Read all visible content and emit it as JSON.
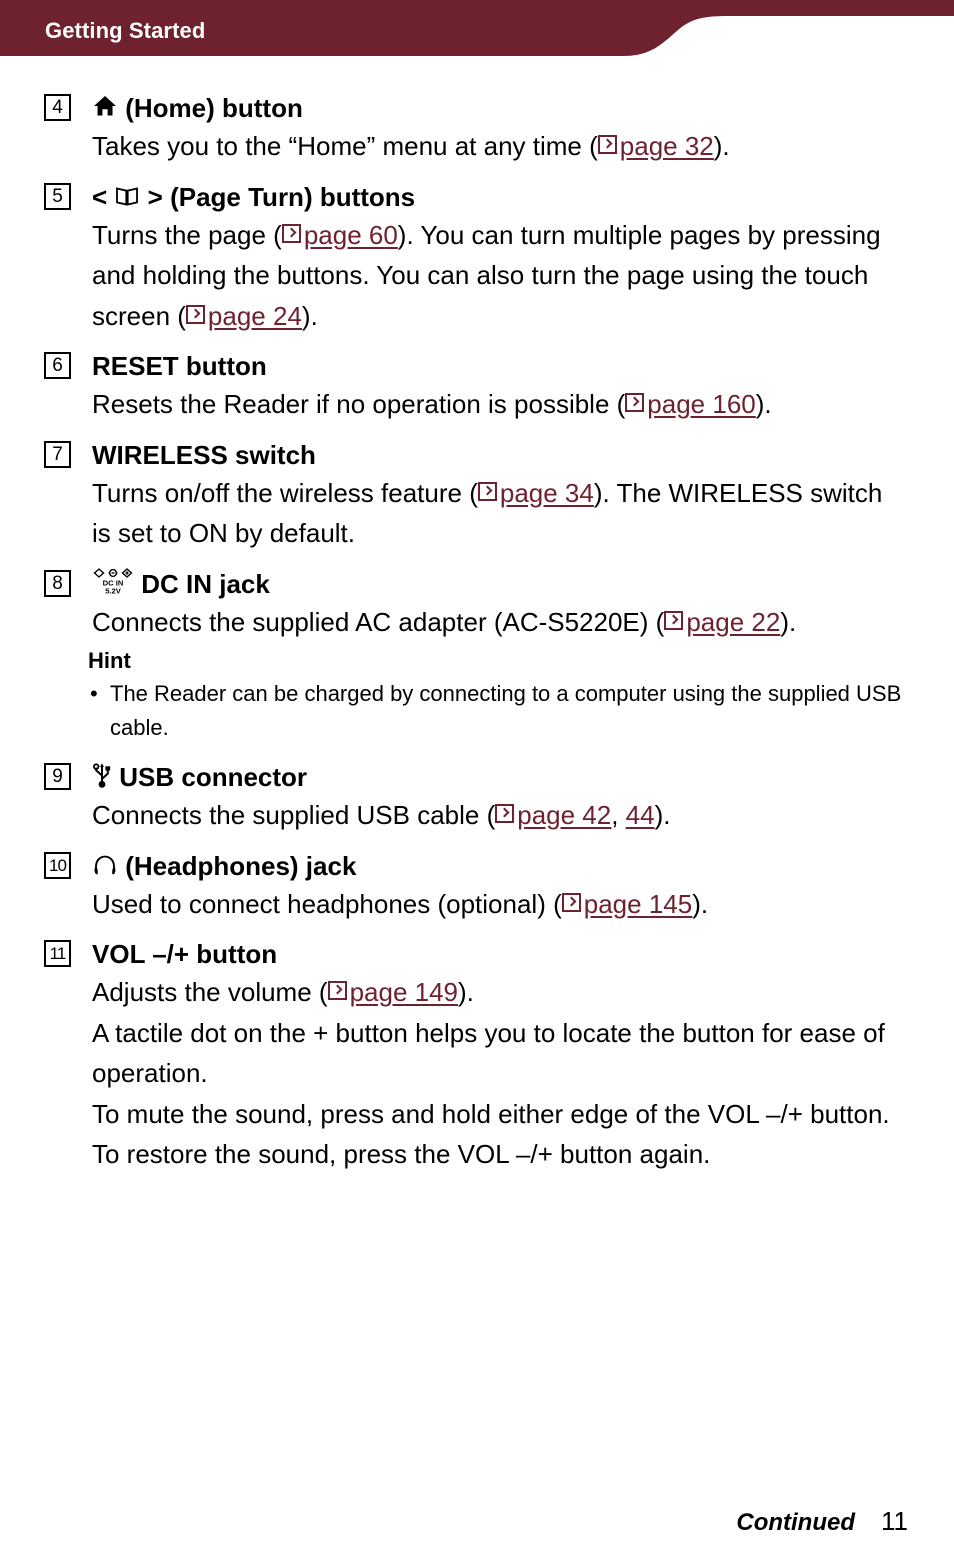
{
  "header": {
    "title": "Getting Started",
    "banner_color": "#6E2230"
  },
  "theme": {
    "accent": "#6E2230",
    "text": "#000000",
    "background": "#FFFFFF"
  },
  "entries": [
    {
      "number": "4",
      "icon": "home-icon",
      "title_text": "(Home) button",
      "body_segments": [
        {
          "type": "text",
          "value": "Takes you to the “Home” menu at any time ("
        },
        {
          "type": "ref",
          "value": "page 32"
        },
        {
          "type": "text",
          "value": ")."
        }
      ]
    },
    {
      "number": "5",
      "icon": "open-book-icon",
      "title_prefix": "<",
      "title_suffix": ">",
      "title_text": "(Page Turn) buttons",
      "body_segments": [
        {
          "type": "text",
          "value": "Turns the page ("
        },
        {
          "type": "ref",
          "value": "page 60"
        },
        {
          "type": "text",
          "value": "). You can turn multiple pages by pressing and holding the buttons. You can also turn the page using the touch screen ("
        },
        {
          "type": "ref",
          "value": "page 24"
        },
        {
          "type": "text",
          "value": ")."
        }
      ]
    },
    {
      "number": "6",
      "icon": null,
      "title_text": "RESET button",
      "body_segments": [
        {
          "type": "text",
          "value": "Resets the Reader if no operation is possible ("
        },
        {
          "type": "ref",
          "value": "page 160"
        },
        {
          "type": "text",
          "value": ")."
        }
      ]
    },
    {
      "number": "7",
      "icon": null,
      "title_text": "WIRELESS switch",
      "body_segments": [
        {
          "type": "text",
          "value": "Turns on/off the wireless feature ("
        },
        {
          "type": "ref",
          "value": "page 34"
        },
        {
          "type": "text",
          "value": "). The WIRELESS switch is set to ON by default."
        }
      ]
    },
    {
      "number": "8",
      "icon": "dc-in-jack-icon",
      "icon_labels": [
        "DC IN",
        "5.2V"
      ],
      "title_text": "DC IN jack",
      "body_segments": [
        {
          "type": "text",
          "value": "Connects the supplied AC adapter (AC-S5220E) ("
        },
        {
          "type": "ref",
          "value": "page 22"
        },
        {
          "type": "text",
          "value": ")."
        }
      ]
    },
    {
      "number": "9",
      "icon": "usb-icon",
      "title_text": "USB connector",
      "body_segments": [
        {
          "type": "text",
          "value": "Connects the supplied USB cable ("
        },
        {
          "type": "ref",
          "value": "page 42"
        },
        {
          "type": "text",
          "value": ", "
        },
        {
          "type": "ref_plain",
          "value": "44"
        },
        {
          "type": "text",
          "value": ")."
        }
      ]
    },
    {
      "number": "10",
      "icon": "headphones-icon",
      "title_text": "(Headphones) jack",
      "body_segments": [
        {
          "type": "text",
          "value": "Used to connect headphones (optional) ("
        },
        {
          "type": "ref",
          "value": "page 145"
        },
        {
          "type": "text",
          "value": ")."
        }
      ]
    },
    {
      "number": "11",
      "icon": null,
      "title_text": "VOL –/+ button",
      "body_segments": [
        {
          "type": "text",
          "value": "Adjusts the volume ("
        },
        {
          "type": "ref",
          "value": "page 149"
        },
        {
          "type": "text",
          "value": ").\nA tactile dot on the + button helps you to locate the button for ease of operation.\nTo mute the sound, press and hold either edge of the VOL –/+ button. To restore the sound, press the VOL –/+ button again."
        }
      ]
    }
  ],
  "hint": {
    "title": "Hint",
    "items": [
      "The Reader can be charged by connecting to a computer using the supplied USB cable."
    ]
  },
  "footer": {
    "continued": "Continued",
    "page_number": "11"
  }
}
